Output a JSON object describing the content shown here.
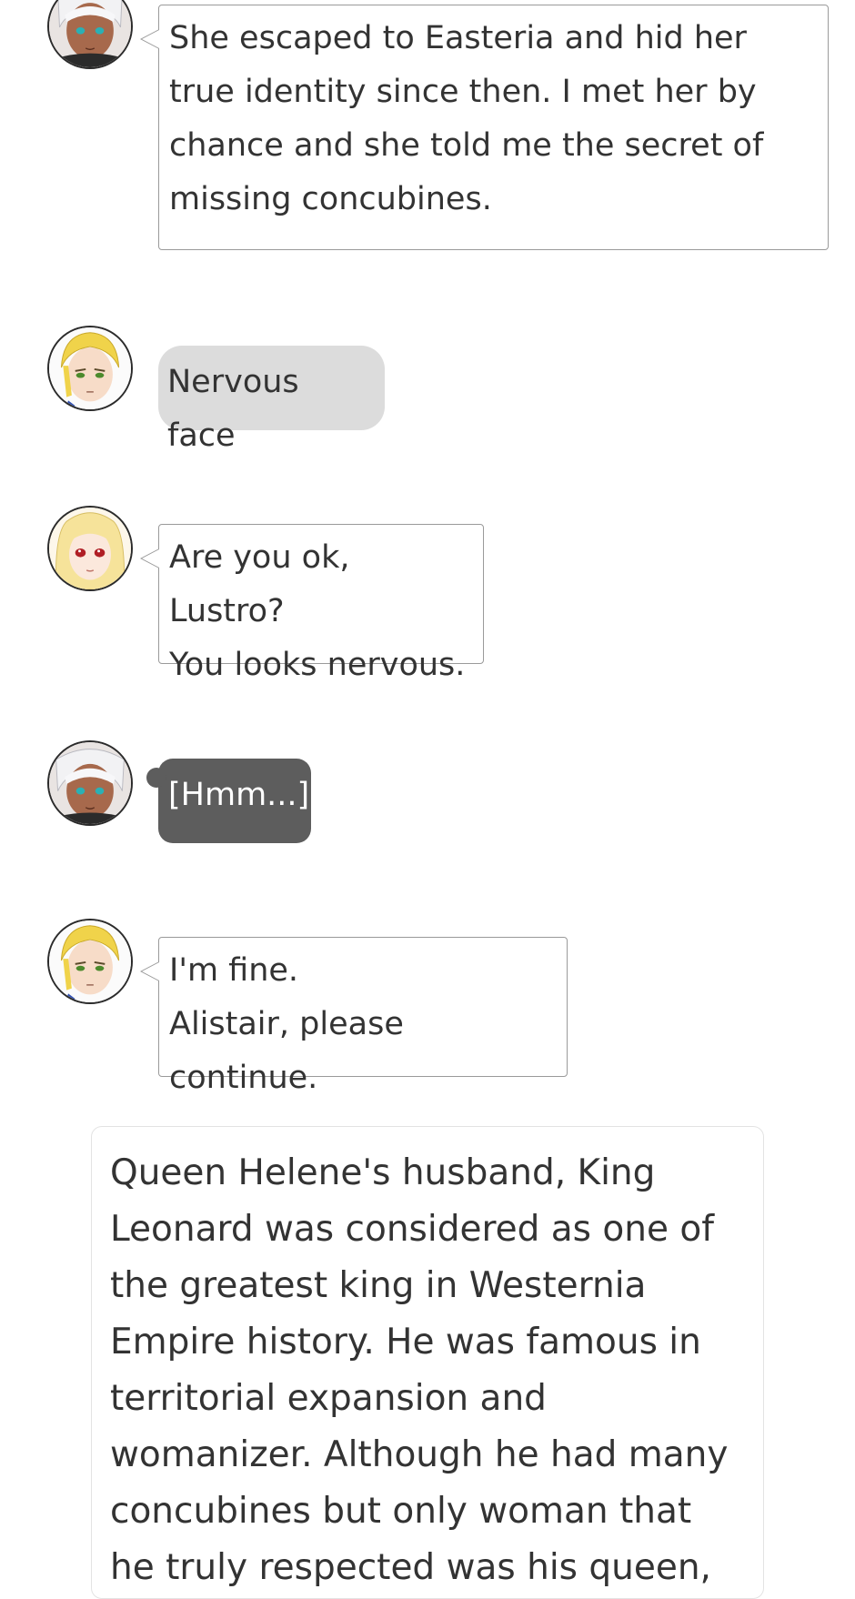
{
  "colors": {
    "speech_border": "#9a9a9a",
    "action_bg": "#dcdcdc",
    "thought_bg": "#5d5d5d",
    "text": "#333333"
  },
  "messages": [
    {
      "type": "speech",
      "avatar": "silver-haired-character-avatar",
      "text": "She escaped to Easteria and hid her true identity since then. I met her by chance and she told me the secret of missing concubines."
    },
    {
      "type": "action",
      "avatar": "blonde-male-character-avatar",
      "text": "Nervous face"
    },
    {
      "type": "speech",
      "avatar": "blonde-female-character-avatar",
      "text": "Are you ok, Lustro?\nYou looks nervous."
    },
    {
      "type": "thought",
      "avatar": "silver-haired-character-avatar",
      "text": "[Hmm...]"
    },
    {
      "type": "speech",
      "avatar": "blonde-male-character-avatar",
      "text": "I'm fine.\nAlistair, please continue."
    }
  ],
  "narration": {
    "text": "Queen Helene's husband, King Leonard was considered as one of the greatest king in Westernia Empire history. He was famous in territorial expansion and womanizer. Although he had many concubines but only woman that he truly respected was his queen, Queen Helene. The queen"
  }
}
